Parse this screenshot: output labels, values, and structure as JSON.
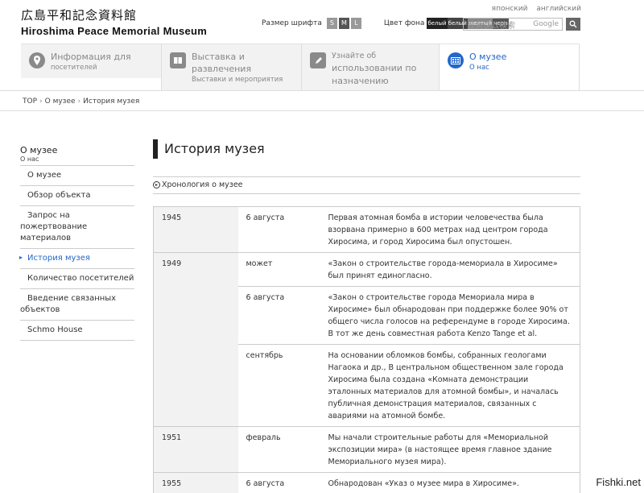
{
  "header": {
    "logo_jp": "広島平和記念資料館",
    "logo_en": "Hiroshima Peace Memorial Museum",
    "lang_links": [
      "японский",
      "английский"
    ],
    "font_size_label": "Размер шрифта",
    "font_sizes": [
      "S",
      "M",
      "L"
    ],
    "bg_color_label": "Цвет фона",
    "bg_options": [
      "белый",
      "белый",
      "желтый",
      "черн"
    ],
    "search_placeholder": "カスタム検索",
    "search_brand": "Google",
    "search_icon": "search-icon"
  },
  "nav": [
    {
      "title": "Информация для",
      "sub": "посетителей",
      "icon": "map-pin-icon"
    },
    {
      "title": "Выставка и развлечения",
      "sub": "Выставки и мероприятия",
      "icon": "book-icon"
    },
    {
      "title": "Узнайте об",
      "title2": "использовании по назначению",
      "icon": "pencil-icon"
    },
    {
      "title": "О музее",
      "sub": "О нас",
      "icon": "building-icon"
    }
  ],
  "breadcrumb": [
    "TOP",
    "О музее",
    "История музея"
  ],
  "sidebar": {
    "title": "О музее",
    "sub": "О нас",
    "items": [
      "О музее",
      "Обзор объекта",
      "Запрос на пожертвование материалов",
      "История музея",
      "Количество посетителей",
      "Введение связанных объектов",
      "Schmo House"
    ],
    "active_index": 3
  },
  "main": {
    "title": "История музея",
    "subhead": "Хронология о музее",
    "rows": [
      {
        "year": "1945",
        "date": "6 августа",
        "text": "Первая атомная бомба в истории человечества была взорвана примерно в 600 метрах над центром города Хиросима, и город Хиросима был опустошен."
      },
      {
        "year": "1949",
        "date": "может",
        "text": "«Закон о строительстве города-мемориала в Хиросиме» был принят единогласно."
      },
      {
        "year": "",
        "date": "6 августа",
        "text": "«Закон о строительстве города Мемориала мира в Хиросиме» был обнародован при поддержке более 90% от общего числа голосов на референдуме в городе Хиросима. В тот же день совместная работа Kenzo Tange et al."
      },
      {
        "year": "",
        "date": "сентябрь",
        "text": "На основании обломков бомбы, собранных геологами Нагаока и др., В центральном общественном зале города Хиросима была создана «Комната демонстрации эталонных материалов для атомной бомбы», и началась публичная демонстрация материалов, связанных с авариями на атомной бомбе."
      },
      {
        "year": "1951",
        "date": "февраль",
        "text": "Мы начали строительные работы для «Мемориальной экспозиции мира» (в настоящее время главное здание Мемориального музея мира)."
      },
      {
        "year": "1955",
        "date": "6 августа",
        "text": "Обнародован «Указ о музее мира в Хиросиме»."
      }
    ]
  },
  "watermark": "Fishki.net",
  "colors": {
    "accent": "#2367c9",
    "nav_bg": "#f2f2f2",
    "year_bg": "#f2f2f2"
  }
}
